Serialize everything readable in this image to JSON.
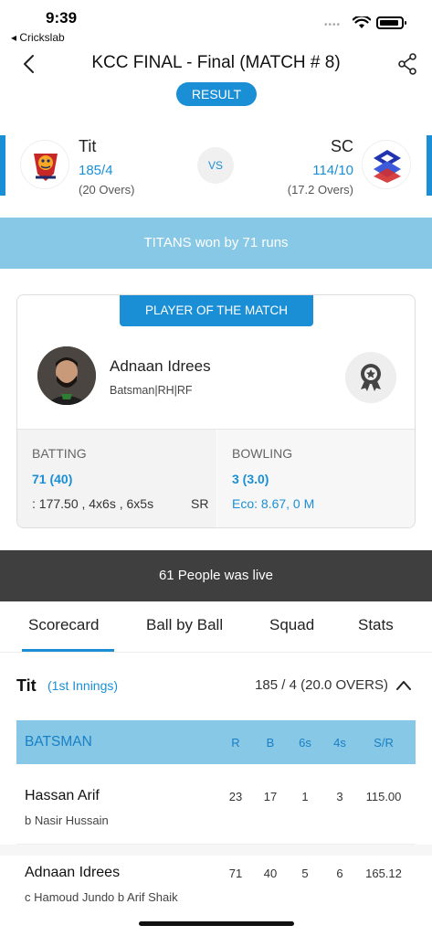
{
  "status_bar": {
    "time": "9:39",
    "back_app": "◂ Crickslab",
    "dots": "••••"
  },
  "header": {
    "title": "KCC FINAL - Final (MATCH # 8)"
  },
  "result_badge": "RESULT",
  "team1": {
    "name": "Tit",
    "score": "185/4",
    "overs": "(20 Overs)",
    "logo": "titans-logo"
  },
  "team2": {
    "name": "SC",
    "score": "114/10",
    "overs": "(17.2 Overs)",
    "logo": "sc-logo"
  },
  "vs_label": "VS",
  "result_text": "TITANS won by 71 runs",
  "potm": {
    "label": "PLAYER OF THE MATCH",
    "name": "Adnaan Idrees",
    "role": "Batsman|RH|RF",
    "batting": {
      "heading": "BATTING",
      "main": "71 (40)",
      "sub": ": 177.50 , 4x6s , 6x5s",
      "sr_label": "SR"
    },
    "bowling": {
      "heading": "BOWLING",
      "main": "3 (3.0)",
      "sub": "Eco: 8.67, 0 M"
    }
  },
  "live_text": "61 People was live",
  "tabs": [
    "Scorecard",
    "Ball by Ball",
    "Squad",
    "Stats"
  ],
  "active_tab": "Scorecard",
  "innings": {
    "team": "Tit",
    "label": "(1st Innings)",
    "score": "185 / 4 (20.0 OVERS)"
  },
  "batsman_table": {
    "header_label": "BATSMAN",
    "columns": [
      "R",
      "B",
      "6s",
      "4s",
      "S/R"
    ],
    "rows": [
      {
        "name": "Hassan Arif",
        "dismissal": "b Nasir Hussain",
        "r": "23",
        "b": "17",
        "six": "1",
        "four": "3",
        "sr": "115.00"
      },
      {
        "name": "Adnaan Idrees",
        "dismissal": "c Hamoud Jundo b Arif Shaik",
        "r": "71",
        "b": "40",
        "six": "5",
        "four": "6",
        "sr": "165.12"
      }
    ]
  },
  "colors": {
    "accent": "#1a8fd6",
    "banner": "#86c8e6",
    "live_bar": "#3f3f3f"
  }
}
